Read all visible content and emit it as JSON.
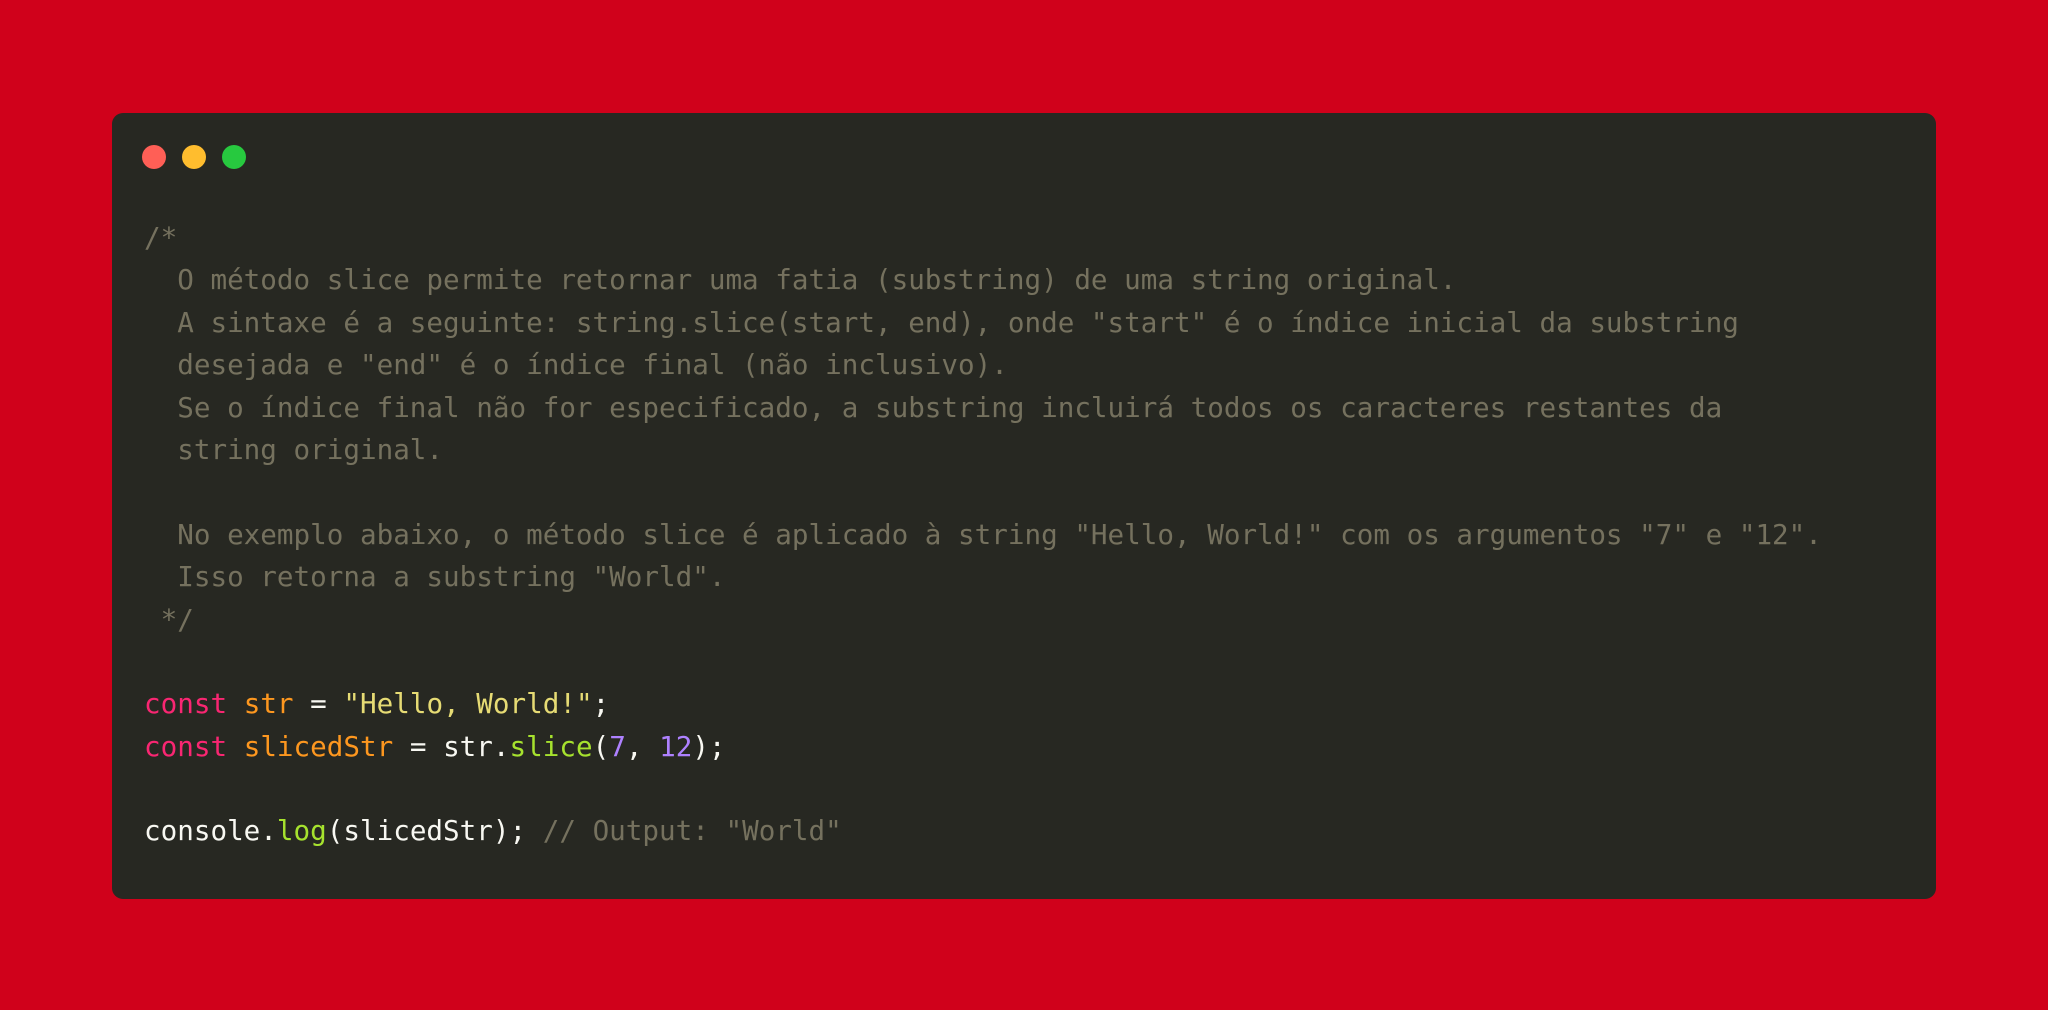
{
  "colors": {
    "background": "#d0011b",
    "window": "#272822",
    "close_dot": "#ff5f56",
    "minimize_dot": "#ffbd2e",
    "maximize_dot": "#27c93f",
    "comment": "#75715e",
    "keyword": "#f92672",
    "variable": "#fd971f",
    "string": "#e6db74",
    "function": "#a6e22e",
    "number": "#ae81ff",
    "plain": "#f8f8f2"
  },
  "code": {
    "comment_lines": [
      "/*",
      "  O método slice permite retornar uma fatia (substring) de uma string original.",
      "  A sintaxe é a seguinte: string.slice(start, end), onde \"start\" é o índice inicial da substring",
      "  desejada e \"end\" é o índice final (não inclusivo).",
      "  Se o índice final não for especificado, a substring incluirá todos os caracteres restantes da",
      "  string original.",
      "",
      "  No exemplo abaixo, o método slice é aplicado à string \"Hello, World!\" com os argumentos \"7\" e \"12\".",
      "  Isso retorna a substring \"World\".",
      " */"
    ],
    "line1": {
      "keyword": "const",
      "var": "str",
      "op": " = ",
      "string": "\"Hello, World!\"",
      "end": ";"
    },
    "line2": {
      "keyword": "const",
      "var": "slicedStr",
      "op": " = ",
      "obj": "str.",
      "method": "slice",
      "paren_open": "(",
      "arg1": "7",
      "sep": ", ",
      "arg2": "12",
      "paren_close": ");"
    },
    "line3": {
      "obj": "console.",
      "method": "log",
      "args": "(slicedStr);",
      "comment": "// Output: \"World\""
    }
  }
}
